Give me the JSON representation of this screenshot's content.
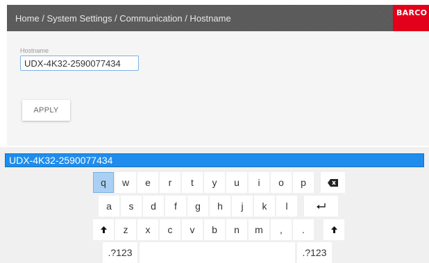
{
  "header": {
    "breadcrumb": "Home / System Settings / Communication / Hostname",
    "logo": "BARCO",
    "logo_color": "#e3001b"
  },
  "form": {
    "hostname_label": "Hostname",
    "hostname_value": "UDX-4K32-2590077434",
    "apply_label": "APPLY"
  },
  "keyboard": {
    "input_text": "UDX-4K32-2590077434",
    "accent_color": "#1f8ded",
    "row1": [
      "q",
      "w",
      "e",
      "r",
      "t",
      "y",
      "u",
      "i",
      "o",
      "p"
    ],
    "row2": [
      "a",
      "s",
      "d",
      "f",
      "g",
      "h",
      "j",
      "k",
      "l"
    ],
    "row3": [
      "z",
      "x",
      "c",
      "v",
      "b",
      "n",
      "m",
      ",",
      "."
    ],
    "symbols_label": ".?123",
    "icons": {
      "backspace": "backspace-icon",
      "enter": "enter-icon",
      "shift": "shift-icon"
    }
  }
}
